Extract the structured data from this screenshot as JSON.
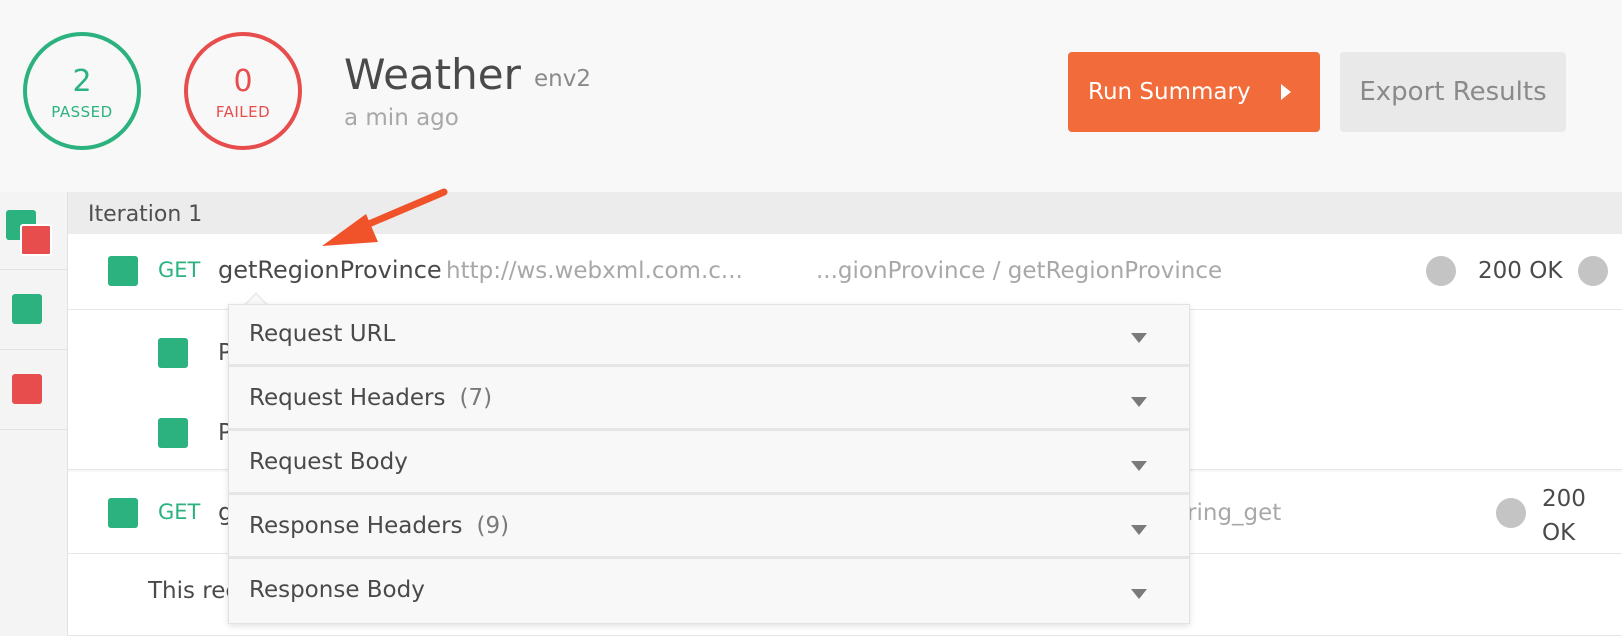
{
  "summary": {
    "passed_count": "2",
    "passed_label": "PASSED",
    "failed_count": "0",
    "failed_label": "FAILED",
    "title": "Weather",
    "environment": "env2",
    "time": "a min ago",
    "run_summary_label": "Run Summary",
    "export_label": "Export Results"
  },
  "iteration": {
    "label": "Iteration 1"
  },
  "requests": [
    {
      "method": "GET",
      "name": "getRegionProvince",
      "url": "http://ws.webxml.com.c...",
      "path": "...gionProvince / getRegionProvince",
      "status": "200 OK"
    },
    {
      "method": "GET",
      "name_partial": "g",
      "path_partial": "tring_get",
      "status_line1": "200",
      "status_line2": "OK"
    }
  ],
  "tests": [
    {
      "text_partial": "P"
    },
    {
      "text_partial": "P"
    }
  ],
  "note_partial": "This rec",
  "details_menu": [
    {
      "label": "Request URL",
      "count": ""
    },
    {
      "label": "Request Headers",
      "count": "(7)"
    },
    {
      "label": "Request Body",
      "count": ""
    },
    {
      "label": "Response Headers",
      "count": "(9)"
    },
    {
      "label": "Response Body",
      "count": ""
    }
  ],
  "colors": {
    "pass": "#2bb27f",
    "fail": "#e84d4d",
    "accent": "#f26b3a",
    "annotation": "#f0532a"
  }
}
